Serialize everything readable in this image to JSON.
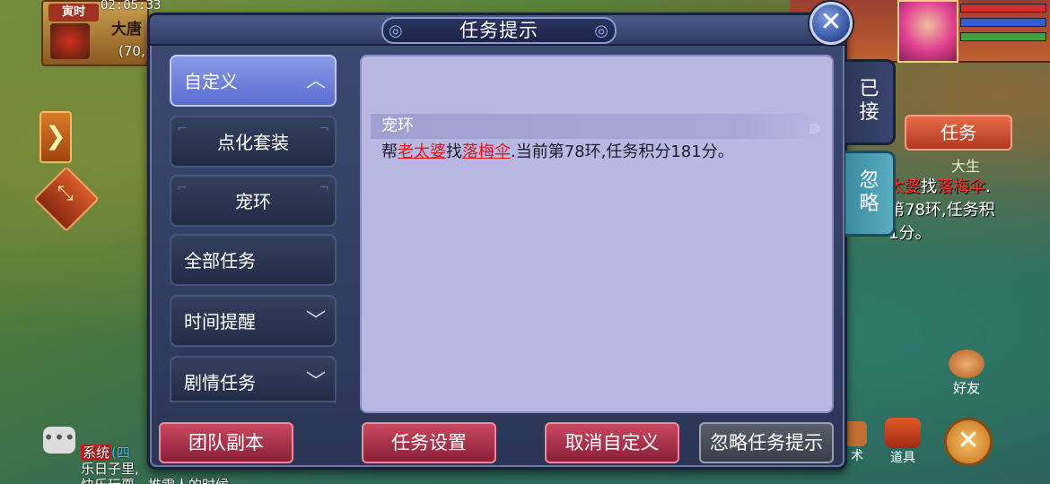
{
  "hud": {
    "shichen": "寅时",
    "clock": "02:05:33",
    "map_name": "大唐",
    "coords": "(70,",
    "task_button": "任务",
    "tracker_npc_label": "大生",
    "tracker_line1_a": "太婆",
    "tracker_line1_b": "找",
    "tracker_line1_c": "落梅伞",
    "tracker_line1_d": ".",
    "tracker_line2": "第78环,任务积",
    "tracker_line3": "1分。",
    "friend_label": "好友",
    "item_label": "道具",
    "skill_label": "术",
    "chat_system_tag": "系统",
    "chat_line1_rest": "(四",
    "chat_line2": "乐日子里,",
    "chat_line3": "快乐玩耍。推雪人的时候"
  },
  "dialog": {
    "title": "任务提示",
    "close_symbol": "✕",
    "menu": [
      {
        "label": "自定义",
        "chevron": "︿"
      },
      {
        "label": "点化套装"
      },
      {
        "label": "宠环"
      },
      {
        "label": "全部任务"
      },
      {
        "label": "时间提醒",
        "chevron": "﹀"
      },
      {
        "label": "剧情任务",
        "chevron": "﹀"
      }
    ],
    "task": {
      "header": "宠环",
      "prefix": "帮",
      "npc": "老太婆",
      "verb": "找",
      "item": "落梅伞",
      "suffix": ".当前第78环,任务积分181分。"
    },
    "side_tabs": [
      {
        "label": "已接"
      },
      {
        "label": "忽略"
      }
    ],
    "buttons": {
      "team_dungeon": "团队副本",
      "task_settings": "任务设置",
      "cancel_custom": "取消自定义",
      "ignore_task_prompt": "忽略任务提示"
    }
  },
  "colors": {
    "dialog_bg": "#2b3656",
    "panel_bg": "#b8b8e2",
    "active_menu": "#6f80dc",
    "link_red": "#e01818",
    "button_red": "#a8304a",
    "button_gray": "#4a4f5c"
  }
}
